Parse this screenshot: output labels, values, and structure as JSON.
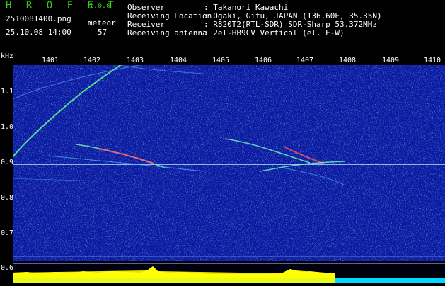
{
  "header": {
    "app_name": "H R O F F T",
    "version": "1.0.0",
    "filename": "2510081400.png",
    "datetime": "25.10.08 14:00",
    "count_label": "meteor",
    "count_value": "57",
    "fields": [
      {
        "label": "Observer",
        "value": ": Takanori Kawachi"
      },
      {
        "label": "Receiving Location",
        "value": ": Ogaki, Gifu, JAPAN (136.60E, 35.35N)"
      },
      {
        "label": "Receiver",
        "value": ": R820T2(RTL-SDR) SDR-Sharp 53.372MHz"
      },
      {
        "label": "Receiving antenna",
        "value": ": 2el-HB9CV Vertical (el. E-W)"
      }
    ]
  },
  "axes": {
    "y_unit": "kHz",
    "x_ticks": [
      "1401",
      "1402",
      "1403",
      "1404",
      "1405",
      "1406",
      "1407",
      "1408",
      "1409",
      "1410"
    ],
    "y_ticks": [
      "1.1",
      "1.0",
      "0.9",
      "0.8",
      "0.7",
      "0.6"
    ]
  },
  "colors": {
    "background": "#0a1aa0",
    "carrier": "#a0e0ff",
    "power_yellow": "#ffff00",
    "power_cyan": "#00e0ff",
    "header_green": "#38c818"
  }
}
